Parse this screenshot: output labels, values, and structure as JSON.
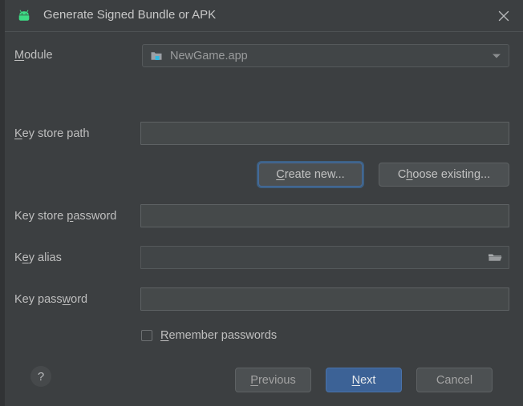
{
  "window": {
    "title": "Generate Signed Bundle or APK",
    "app_icon": "android-robot-icon",
    "close_label": "✕"
  },
  "form": {
    "module": {
      "label_pre": "",
      "label_mn": "M",
      "label_post": "odule",
      "value": "NewGame.app",
      "icon": "module-folder-icon"
    },
    "key_store_path": {
      "label_pre": "",
      "label_mn": "K",
      "label_post": "ey store path",
      "value": "",
      "placeholder": ""
    },
    "key_store_password": {
      "label_pre": "Key store ",
      "label_mn": "p",
      "label_post": "assword",
      "value": "",
      "placeholder": ""
    },
    "key_alias": {
      "label_pre": "K",
      "label_mn": "e",
      "label_post": "y alias",
      "value": "",
      "placeholder": "",
      "browse_icon": "open-folder-icon"
    },
    "key_password": {
      "label_pre": "Key pass",
      "label_mn": "w",
      "label_post": "ord",
      "value": "",
      "placeholder": ""
    },
    "remember_passwords": {
      "label_pre": "",
      "label_mn": "R",
      "label_post": "emember passwords",
      "checked": false
    }
  },
  "keystore_buttons": {
    "create_new": {
      "pre": "",
      "mn": "C",
      "post": "reate new..."
    },
    "choose_existing": {
      "pre": "C",
      "mn": "h",
      "post": "oose existing..."
    }
  },
  "footer": {
    "help": "?",
    "previous": {
      "pre": "",
      "mn": "P",
      "post": "revious"
    },
    "next": {
      "pre": "",
      "mn": "N",
      "post": "ext"
    },
    "cancel": {
      "pre": "Cancel",
      "mn": "",
      "post": ""
    }
  },
  "colors": {
    "dialog_bg": "#3c3f41",
    "field_bg": "#45494a",
    "field_border": "#5e6264",
    "accent_blue": "#3c6296",
    "focus_ring": "#466b9c",
    "text": "#bfbfbf",
    "android_green": "#3ddc84"
  }
}
